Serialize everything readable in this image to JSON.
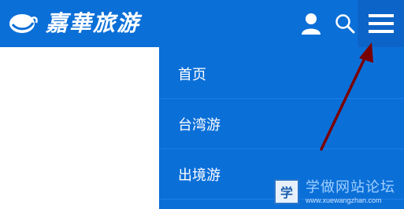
{
  "header": {
    "brand_text": "嘉華旅游",
    "icons": [
      "user-icon",
      "search-icon",
      "hamburger-menu-icon"
    ],
    "colors": {
      "bar": "#0b6fd8",
      "menu_button_bg": "#0d64c8",
      "icon": "#ffffff"
    }
  },
  "menu": {
    "items": [
      {
        "label": "首页"
      },
      {
        "label": "台湾游"
      },
      {
        "label": "出境游"
      }
    ]
  },
  "annotation": {
    "type": "arrow",
    "color": "#7a0000",
    "points_to": "hamburger-menu-icon"
  },
  "watermark": {
    "icon_char": "学",
    "title": "学做网站论坛",
    "subtitle": "www.xuewangzhan.com"
  }
}
